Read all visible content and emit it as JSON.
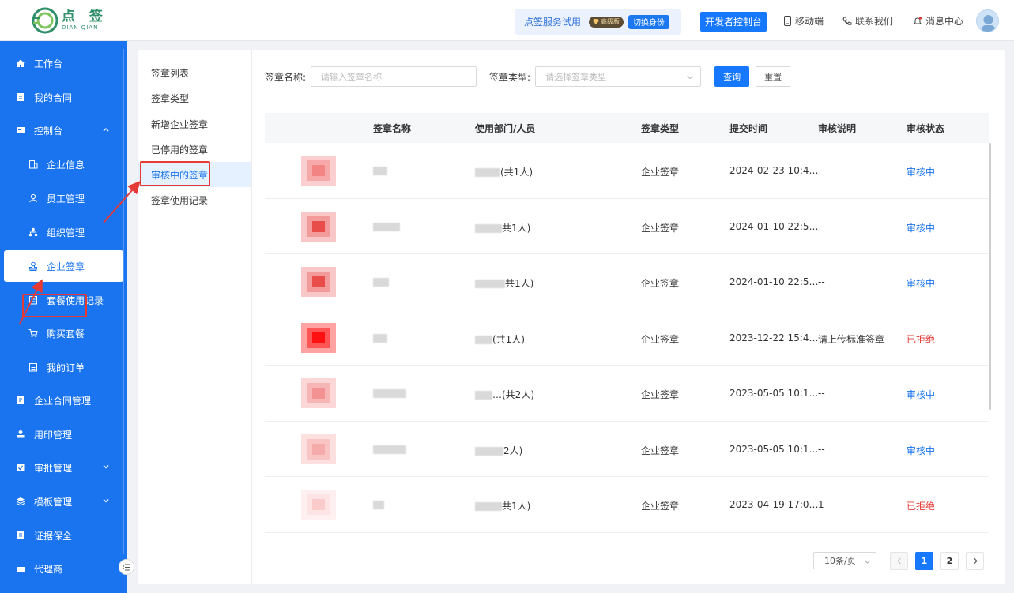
{
  "header": {
    "logo_cn": "点 签",
    "logo_en": "DIAN QIAN",
    "trial_text": "点签服务试用",
    "tier_badge": "高级版",
    "switch_identity": "切换身份",
    "developer_console": "开发者控制台",
    "mobile": "移动端",
    "contact": "联系我们",
    "messages": "消息中心"
  },
  "sidebar": {
    "items": [
      {
        "label": "工作台",
        "icon": "home-icon"
      },
      {
        "label": "我的合同",
        "icon": "contract-icon"
      },
      {
        "label": "控制台",
        "icon": "console-icon"
      },
      {
        "label": "企业信息",
        "icon": "building-icon"
      },
      {
        "label": "员工管理",
        "icon": "user-icon"
      },
      {
        "label": "组织管理",
        "icon": "org-icon"
      },
      {
        "label": "企业签章",
        "icon": "stamp-icon"
      },
      {
        "label": "套餐使用记录",
        "icon": "record-icon"
      },
      {
        "label": "购买套餐",
        "icon": "cart-icon"
      },
      {
        "label": "我的订单",
        "icon": "order-icon"
      },
      {
        "label": "企业合同管理",
        "icon": "contract-mgmt-icon"
      },
      {
        "label": "用印管理",
        "icon": "seal-use-icon"
      },
      {
        "label": "审批管理",
        "icon": "approval-icon"
      },
      {
        "label": "模板管理",
        "icon": "template-icon"
      },
      {
        "label": "证据保全",
        "icon": "evidence-icon"
      },
      {
        "label": "代理商",
        "icon": "agent-icon"
      }
    ]
  },
  "subnav": {
    "items": [
      "签章列表",
      "签章类型",
      "新增企业签章",
      "已停用的签章",
      "审核中的签章",
      "签章使用记录"
    ]
  },
  "search": {
    "name_label": "签章名称:",
    "name_placeholder": "请输入签章名称",
    "type_label": "签章类型:",
    "type_placeholder": "请选择签章类型",
    "query_btn": "查询",
    "reset_btn": "重置"
  },
  "table": {
    "columns": [
      "签章名称",
      "使用部门/人员",
      "签章类型",
      "提交时间",
      "审核说明",
      "审核状态"
    ],
    "rows": [
      {
        "dept_suffix": "(共1人)",
        "type": "企业签章",
        "time": "2024-02-23 10:4…",
        "note": "--",
        "status": "审核中",
        "status_kind": "pending"
      },
      {
        "dept_suffix": "共1人)",
        "type": "企业签章",
        "time": "2024-01-10 22:5…",
        "note": "--",
        "status": "审核中",
        "status_kind": "pending"
      },
      {
        "dept_suffix": "共1人)",
        "type": "企业签章",
        "time": "2024-01-10 22:5…",
        "note": "--",
        "status": "审核中",
        "status_kind": "pending"
      },
      {
        "dept_suffix": "(共1人)",
        "type": "企业签章",
        "time": "2023-12-22 15:4…",
        "note": "请上传标准签章",
        "status": "已拒绝",
        "status_kind": "rejected"
      },
      {
        "dept_suffix": "…(共2人)",
        "type": "企业签章",
        "time": "2023-05-05 10:1…",
        "note": "--",
        "status": "审核中",
        "status_kind": "pending"
      },
      {
        "dept_suffix": "2人)",
        "type": "企业签章",
        "time": "2023-05-05 10:1…",
        "note": "--",
        "status": "审核中",
        "status_kind": "pending"
      },
      {
        "dept_suffix": "共1人)",
        "type": "企业签章",
        "time": "2023-04-19 17:0…",
        "note": "1",
        "status": "已拒绝",
        "status_kind": "rejected"
      }
    ]
  },
  "pagination": {
    "page_size": "10条/页",
    "pages": [
      "1",
      "2"
    ],
    "current": "1"
  },
  "colors": {
    "primary": "#1a74ef",
    "rejected": "#e53935",
    "annotation": "#e53935"
  }
}
